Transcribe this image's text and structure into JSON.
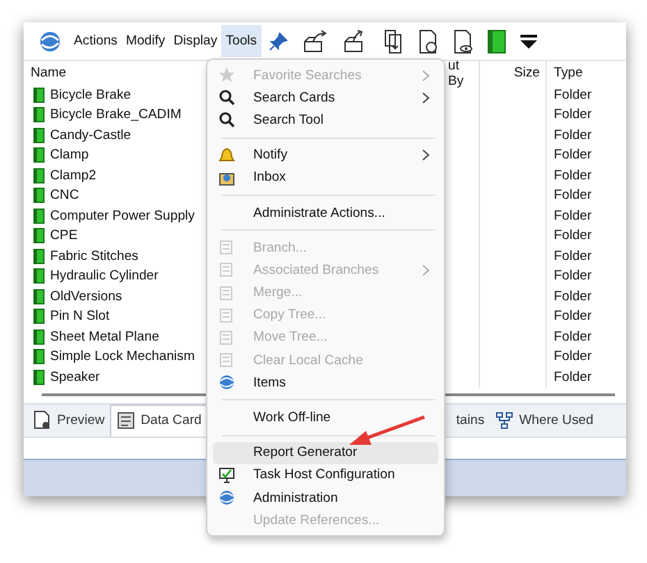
{
  "toolbar": {
    "menus": [
      {
        "label": "Actions",
        "selected": false
      },
      {
        "label": "Modify",
        "selected": false
      },
      {
        "label": "Display",
        "selected": false
      },
      {
        "label": "Tools",
        "selected": true
      }
    ]
  },
  "table": {
    "columns": [
      "Name",
      "ut By",
      "Size",
      "Type"
    ],
    "rows": [
      {
        "name": "Bicycle Brake",
        "type": "Folder"
      },
      {
        "name": "Bicycle Brake_CADIM",
        "type": "Folder"
      },
      {
        "name": "Candy-Castle",
        "type": "Folder"
      },
      {
        "name": "Clamp",
        "type": "Folder"
      },
      {
        "name": "Clamp2",
        "type": "Folder"
      },
      {
        "name": "CNC",
        "type": "Folder"
      },
      {
        "name": "Computer Power Supply",
        "type": "Folder"
      },
      {
        "name": "CPE",
        "type": "Folder"
      },
      {
        "name": "Fabric Stitches",
        "type": "Folder"
      },
      {
        "name": "Hydraulic Cylinder",
        "type": "Folder"
      },
      {
        "name": "OldVersions",
        "type": "Folder"
      },
      {
        "name": "Pin N Slot",
        "type": "Folder"
      },
      {
        "name": "Sheet Metal Plane",
        "type": "Folder"
      },
      {
        "name": "Simple Lock Mechanism",
        "type": "Folder"
      },
      {
        "name": "Speaker",
        "type": "Folder"
      }
    ]
  },
  "tabs": [
    {
      "label": "Preview",
      "selected": false
    },
    {
      "label": "Data Card",
      "selected": true
    },
    {
      "label": "tains",
      "selected": false
    },
    {
      "label": "Where Used",
      "selected": false
    }
  ],
  "tools_menu": {
    "items": [
      {
        "kind": "item",
        "label": "Favorite Searches",
        "disabled": true,
        "submenu": true,
        "highlighted": false
      },
      {
        "kind": "item",
        "label": "Search Cards",
        "disabled": false,
        "submenu": true,
        "highlighted": false
      },
      {
        "kind": "item",
        "label": "Search Tool",
        "disabled": false,
        "submenu": false,
        "highlighted": false
      },
      {
        "kind": "separator"
      },
      {
        "kind": "item",
        "label": "Notify",
        "disabled": false,
        "submenu": true,
        "highlighted": false
      },
      {
        "kind": "item",
        "label": "Inbox",
        "disabled": false,
        "submenu": false,
        "highlighted": false
      },
      {
        "kind": "separator"
      },
      {
        "kind": "item",
        "label": "Administrate Actions...",
        "disabled": false,
        "submenu": false,
        "highlighted": false
      },
      {
        "kind": "separator"
      },
      {
        "kind": "item",
        "label": "Branch...",
        "disabled": true,
        "submenu": false,
        "highlighted": false
      },
      {
        "kind": "item",
        "label": "Associated Branches",
        "disabled": true,
        "submenu": true,
        "highlighted": false
      },
      {
        "kind": "item",
        "label": "Merge...",
        "disabled": true,
        "submenu": false,
        "highlighted": false
      },
      {
        "kind": "item",
        "label": "Copy Tree...",
        "disabled": true,
        "submenu": false,
        "highlighted": false
      },
      {
        "kind": "item",
        "label": "Move Tree...",
        "disabled": true,
        "submenu": false,
        "highlighted": false
      },
      {
        "kind": "item",
        "label": "Clear Local Cache",
        "disabled": true,
        "submenu": false,
        "highlighted": false
      },
      {
        "kind": "item",
        "label": "Items",
        "disabled": false,
        "submenu": false,
        "highlighted": false
      },
      {
        "kind": "separator"
      },
      {
        "kind": "item",
        "label": "Work Off-line",
        "disabled": false,
        "submenu": false,
        "highlighted": false
      },
      {
        "kind": "separator"
      },
      {
        "kind": "item",
        "label": "Report Generator",
        "disabled": false,
        "submenu": false,
        "highlighted": true
      },
      {
        "kind": "item",
        "label": "Task Host Configuration",
        "disabled": false,
        "submenu": false,
        "highlighted": false
      },
      {
        "kind": "item",
        "label": "Administration",
        "disabled": false,
        "submenu": false,
        "highlighted": false
      },
      {
        "kind": "item",
        "label": "Update References...",
        "disabled": true,
        "submenu": false,
        "highlighted": false
      }
    ]
  }
}
